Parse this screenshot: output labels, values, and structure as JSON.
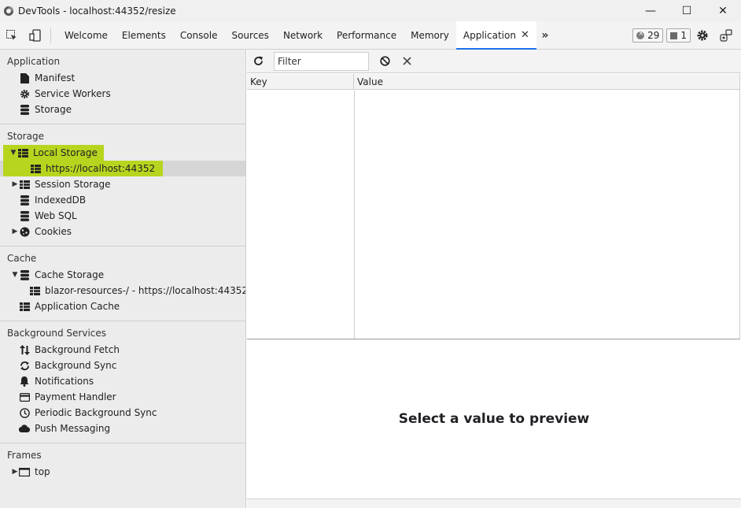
{
  "window": {
    "title": "DevTools - localhost:44352/resize",
    "minimize": "—",
    "maximize": "☐",
    "close": "✕"
  },
  "tabs": [
    {
      "label": "Welcome"
    },
    {
      "label": "Elements"
    },
    {
      "label": "Console"
    },
    {
      "label": "Sources"
    },
    {
      "label": "Network"
    },
    {
      "label": "Performance"
    },
    {
      "label": "Memory"
    },
    {
      "label": "Application",
      "active": true
    }
  ],
  "tab_close": "✕",
  "more_tabs": "»",
  "badges": {
    "errors": "29",
    "messages": "1"
  },
  "sidebar": {
    "application": {
      "title": "Application",
      "items": [
        "Manifest",
        "Service Workers",
        "Storage"
      ]
    },
    "storage": {
      "title": "Storage",
      "local_storage": "Local Storage",
      "local_storage_child": "https://localhost:44352",
      "session_storage": "Session Storage",
      "indexeddb": "IndexedDB",
      "websql": "Web SQL",
      "cookies": "Cookies"
    },
    "cache": {
      "title": "Cache",
      "cache_storage": "Cache Storage",
      "cache_child": "blazor-resources-/ - https://localhost:44352",
      "application_cache": "Application Cache"
    },
    "background": {
      "title": "Background Services",
      "items": [
        "Background Fetch",
        "Background Sync",
        "Notifications",
        "Payment Handler",
        "Periodic Background Sync",
        "Push Messaging"
      ]
    },
    "frames": {
      "title": "Frames",
      "top": "top"
    }
  },
  "toolbar": {
    "filter_placeholder": "Filter"
  },
  "table": {
    "columns": [
      "Key",
      "Value"
    ]
  },
  "preview_text": "Select a value to preview",
  "colors": {
    "highlight": "#b7d51f",
    "active_tab_underline": "#1a73e8"
  }
}
